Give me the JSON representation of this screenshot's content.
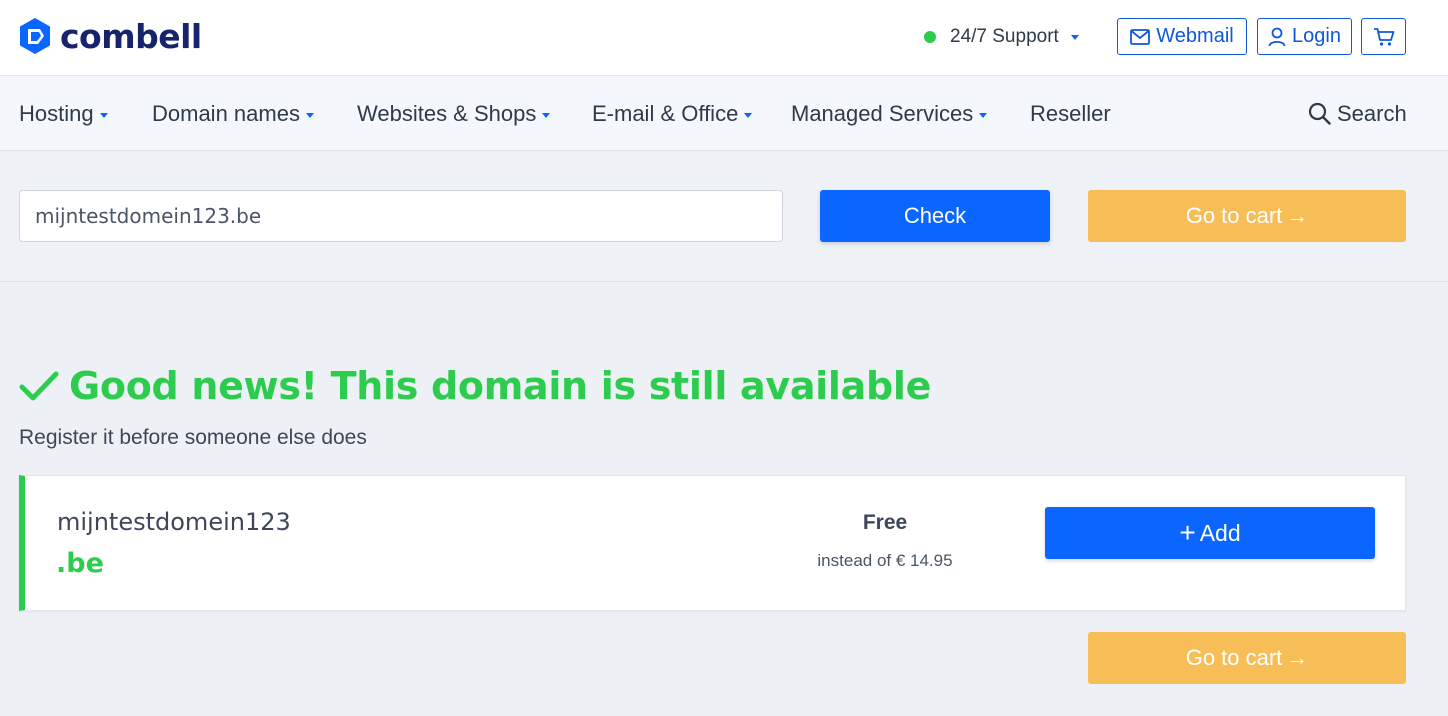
{
  "header": {
    "logo_text": "combell",
    "support_label": "24/7 Support",
    "webmail_label": "Webmail",
    "login_label": "Login"
  },
  "nav": {
    "items": [
      {
        "label": "Hosting"
      },
      {
        "label": "Domain names"
      },
      {
        "label": "Websites & Shops"
      },
      {
        "label": "E-mail & Office"
      },
      {
        "label": "Managed Services"
      },
      {
        "label": "Reseller"
      }
    ],
    "search_label": "Search"
  },
  "search_form": {
    "domain_value": "mijntestdomein123.be",
    "check_label": "Check",
    "cart_label": "Go to cart",
    "cart_arrow": "→"
  },
  "result": {
    "headline": "Good news! This domain is still available",
    "subline": "Register it before someone else does",
    "domain_name": "mijntestdomein123",
    "tld": ".be",
    "price": "Free",
    "price_original": "instead of € 14.95",
    "add_label": "Add",
    "add_icon": "+",
    "cart_label": "Go to cart",
    "cart_arrow": "→"
  },
  "colors": {
    "primary_blue": "#0a66ff",
    "brand_navy": "#15246b",
    "success_green": "#2dcc4f",
    "cart_orange": "#f7be58"
  }
}
